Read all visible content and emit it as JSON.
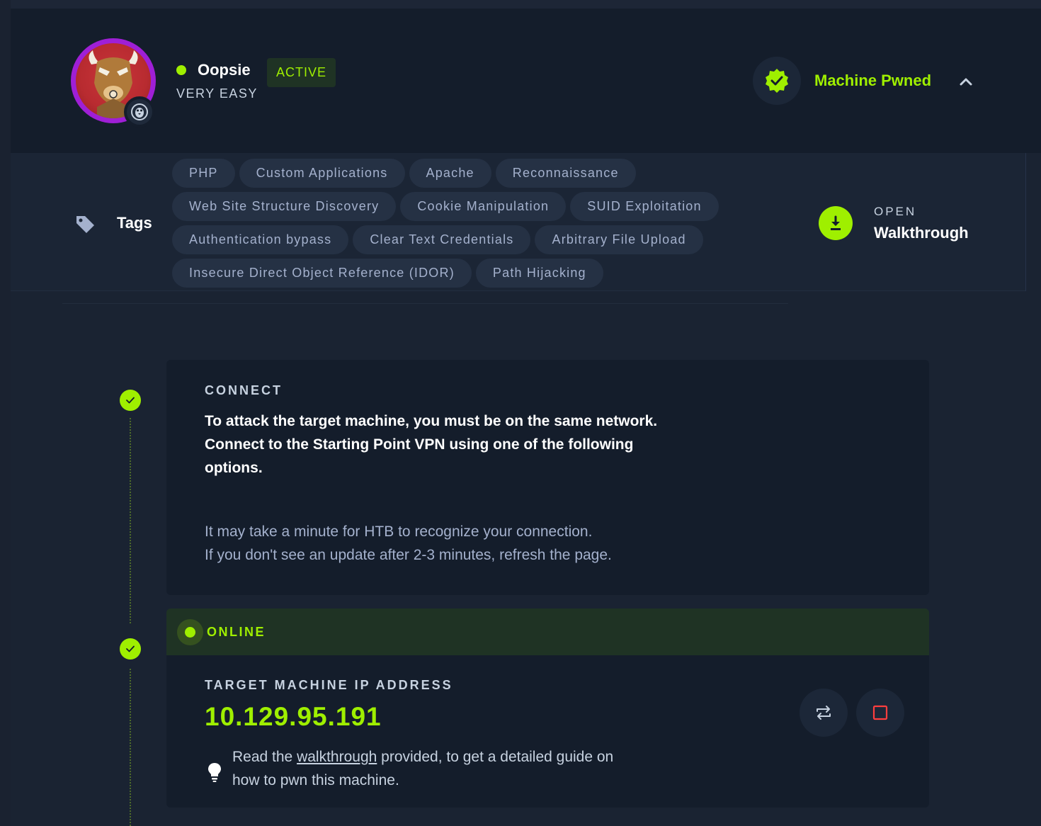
{
  "machine": {
    "name": "Oopsie",
    "difficulty": "VERY EASY",
    "status_badge": "ACTIVE",
    "pwned_label": "Machine Pwned"
  },
  "tags": {
    "label": "Tags",
    "items": [
      "PHP",
      "Custom Applications",
      "Apache",
      "Reconnaissance",
      "Web Site Structure Discovery",
      "Cookie Manipulation",
      "SUID Exploitation",
      "Authentication bypass",
      "Clear Text Credentials",
      "Arbitrary File Upload",
      "Insecure Direct Object Reference (IDOR)",
      "Path Hijacking"
    ]
  },
  "walkthrough": {
    "open_label": "OPEN",
    "label": "Walkthrough"
  },
  "connect": {
    "title": "CONNECT",
    "main_line1": "To attack the target machine, you must be on the same network.",
    "main_line2": "Connect to the Starting Point VPN using one of the following options.",
    "sub_line1": "It may take a minute for HTB to recognize your connection.",
    "sub_line2": "If you don't see an update after 2-3 minutes, refresh the page."
  },
  "target": {
    "status": "ONLINE",
    "ip_title": "TARGET MACHINE IP ADDRESS",
    "ip": "10.129.95.191",
    "hint_prefix": "Read the ",
    "hint_link": "walkthrough",
    "hint_suffix": " provided, to get a detailed guide on how to pwn this machine."
  },
  "colors": {
    "accent": "#9fef00",
    "background": "#1a2332",
    "panel": "#141d2b",
    "tag_bg": "#253144",
    "avatar_ring": "#9f1fd6",
    "stop_red": "#ff3e3e"
  },
  "icons": {
    "os": "linux-penguin-icon",
    "pwned": "verified-badge-icon",
    "collapse": "chevron-up-icon",
    "tags": "tag-icon",
    "walkthrough": "download-icon",
    "step": "check-icon",
    "reset": "reset-machine-icon",
    "stop": "stop-machine-icon",
    "hint": "lightbulb-icon"
  }
}
